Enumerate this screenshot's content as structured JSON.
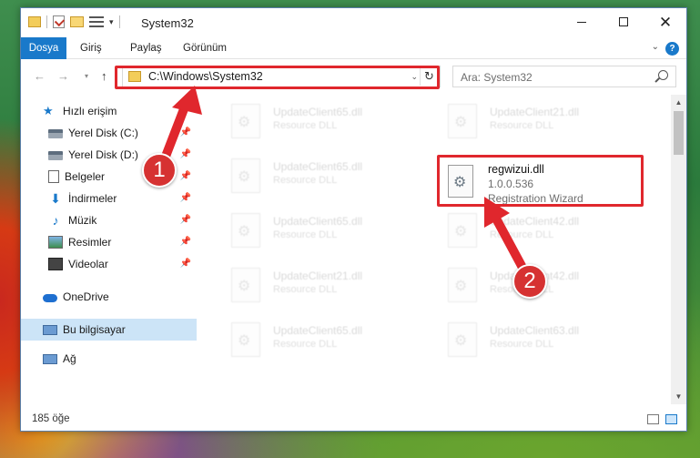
{
  "window": {
    "title": "System32",
    "buttons": {
      "minimize": "—",
      "maximize": "☐",
      "close": "✕"
    }
  },
  "ribbon": {
    "tabs": [
      "Dosya",
      "Giriş",
      "Paylaş",
      "Görünüm"
    ],
    "help": "?"
  },
  "navbar": {
    "back": "←",
    "forward": "→",
    "recent": "▾",
    "up": "↑",
    "address": "C:\\Windows\\System32",
    "refresh": "↻",
    "search_placeholder": "Ara: System32"
  },
  "sidebar": {
    "items": [
      {
        "label": "Hızlı erişim",
        "icon": "star-icon",
        "pinned": false
      },
      {
        "label": "Yerel Disk (C:)",
        "icon": "drive-icon",
        "pinned": true
      },
      {
        "label": "Yerel Disk (D:)",
        "icon": "drive-icon",
        "pinned": true
      },
      {
        "label": "Belgeler",
        "icon": "documents-icon",
        "pinned": true
      },
      {
        "label": "İndirmeler",
        "icon": "downloads-icon",
        "pinned": true
      },
      {
        "label": "Müzik",
        "icon": "music-icon",
        "pinned": true
      },
      {
        "label": "Resimler",
        "icon": "pictures-icon",
        "pinned": true
      },
      {
        "label": "Videolar",
        "icon": "videos-icon",
        "pinned": true
      },
      {
        "label": "OneDrive",
        "icon": "onedrive-icon",
        "pinned": false
      },
      {
        "label": "Bu bilgisayar",
        "icon": "this-pc-icon",
        "pinned": false,
        "selected": true
      },
      {
        "label": "Ağ",
        "icon": "network-icon",
        "pinned": false
      }
    ],
    "pin_glyph": "📌"
  },
  "files": {
    "faded": [
      {
        "name": "UpdateClient65.dll",
        "desc": "Resource DLL"
      },
      {
        "name": "UpdateClient21.dll",
        "desc": "Resource DLL"
      },
      {
        "name": "UpdateClient65.dll",
        "desc": "Resource DLL"
      },
      {
        "name": "UpdateClient65.dll",
        "desc": "Resource DLL"
      },
      {
        "name": "UpdateClient42.dll",
        "desc": "Resource DLL"
      },
      {
        "name": "UpdateClient21.dll",
        "desc": "Resource DLL"
      },
      {
        "name": "UpdateClient42.dll",
        "desc": "Resource DLL"
      },
      {
        "name": "UpdateClient65.dll",
        "desc": "Resource DLL"
      },
      {
        "name": "UpdateClient63.dll",
        "desc": "Resource DLL"
      }
    ],
    "highlighted": {
      "name": "regwizui.dll",
      "version": "1.0.0.536",
      "description": "Registration Wizard"
    }
  },
  "status": {
    "count": "185 öğe"
  },
  "annotations": {
    "badge1": "1",
    "badge2": "2",
    "color": "#e0272d"
  }
}
